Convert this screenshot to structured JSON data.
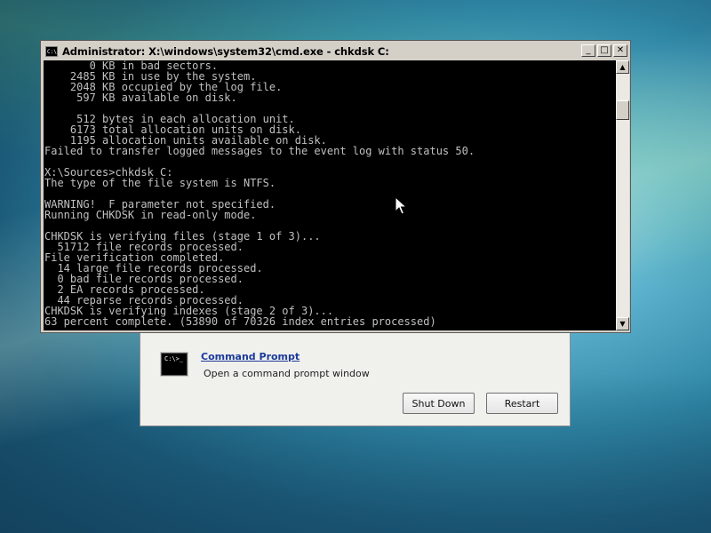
{
  "recovery_dialog": {
    "command_prompt_icon_text": "C:\\>_",
    "command_prompt_link": "Command Prompt",
    "command_prompt_desc": "Open a command prompt window",
    "shut_down_label": "Shut Down",
    "restart_label": "Restart"
  },
  "cmd_window": {
    "title": "Administrator: X:\\windows\\system32\\cmd.exe - chkdsk  C:",
    "icon_text": "C:\\",
    "controls": {
      "minimize": "_",
      "maximize": "□",
      "close": "✕"
    },
    "scroll_up": "▲",
    "scroll_down": "▼",
    "console_text": "       0 KB in bad sectors.\n    2485 KB in use by the system.\n    2048 KB occupied by the log file.\n     597 KB available on disk.\n\n     512 bytes in each allocation unit.\n    6173 total allocation units on disk.\n    1195 allocation units available on disk.\nFailed to transfer logged messages to the event log with status 50.\n\nX:\\Sources>chkdsk C:\nThe type of the file system is NTFS.\n\nWARNING!  F parameter not specified.\nRunning CHKDSK in read-only mode.\n\nCHKDSK is verifying files (stage 1 of 3)...\n  51712 file records processed.\nFile verification completed.\n  14 large file records processed.\n  0 bad file records processed.\n  2 EA records processed.\n  44 reparse records processed.\nCHKDSK is verifying indexes (stage 2 of 3)...\n63 percent complete. (53890 of 70326 index entries processed)"
  }
}
